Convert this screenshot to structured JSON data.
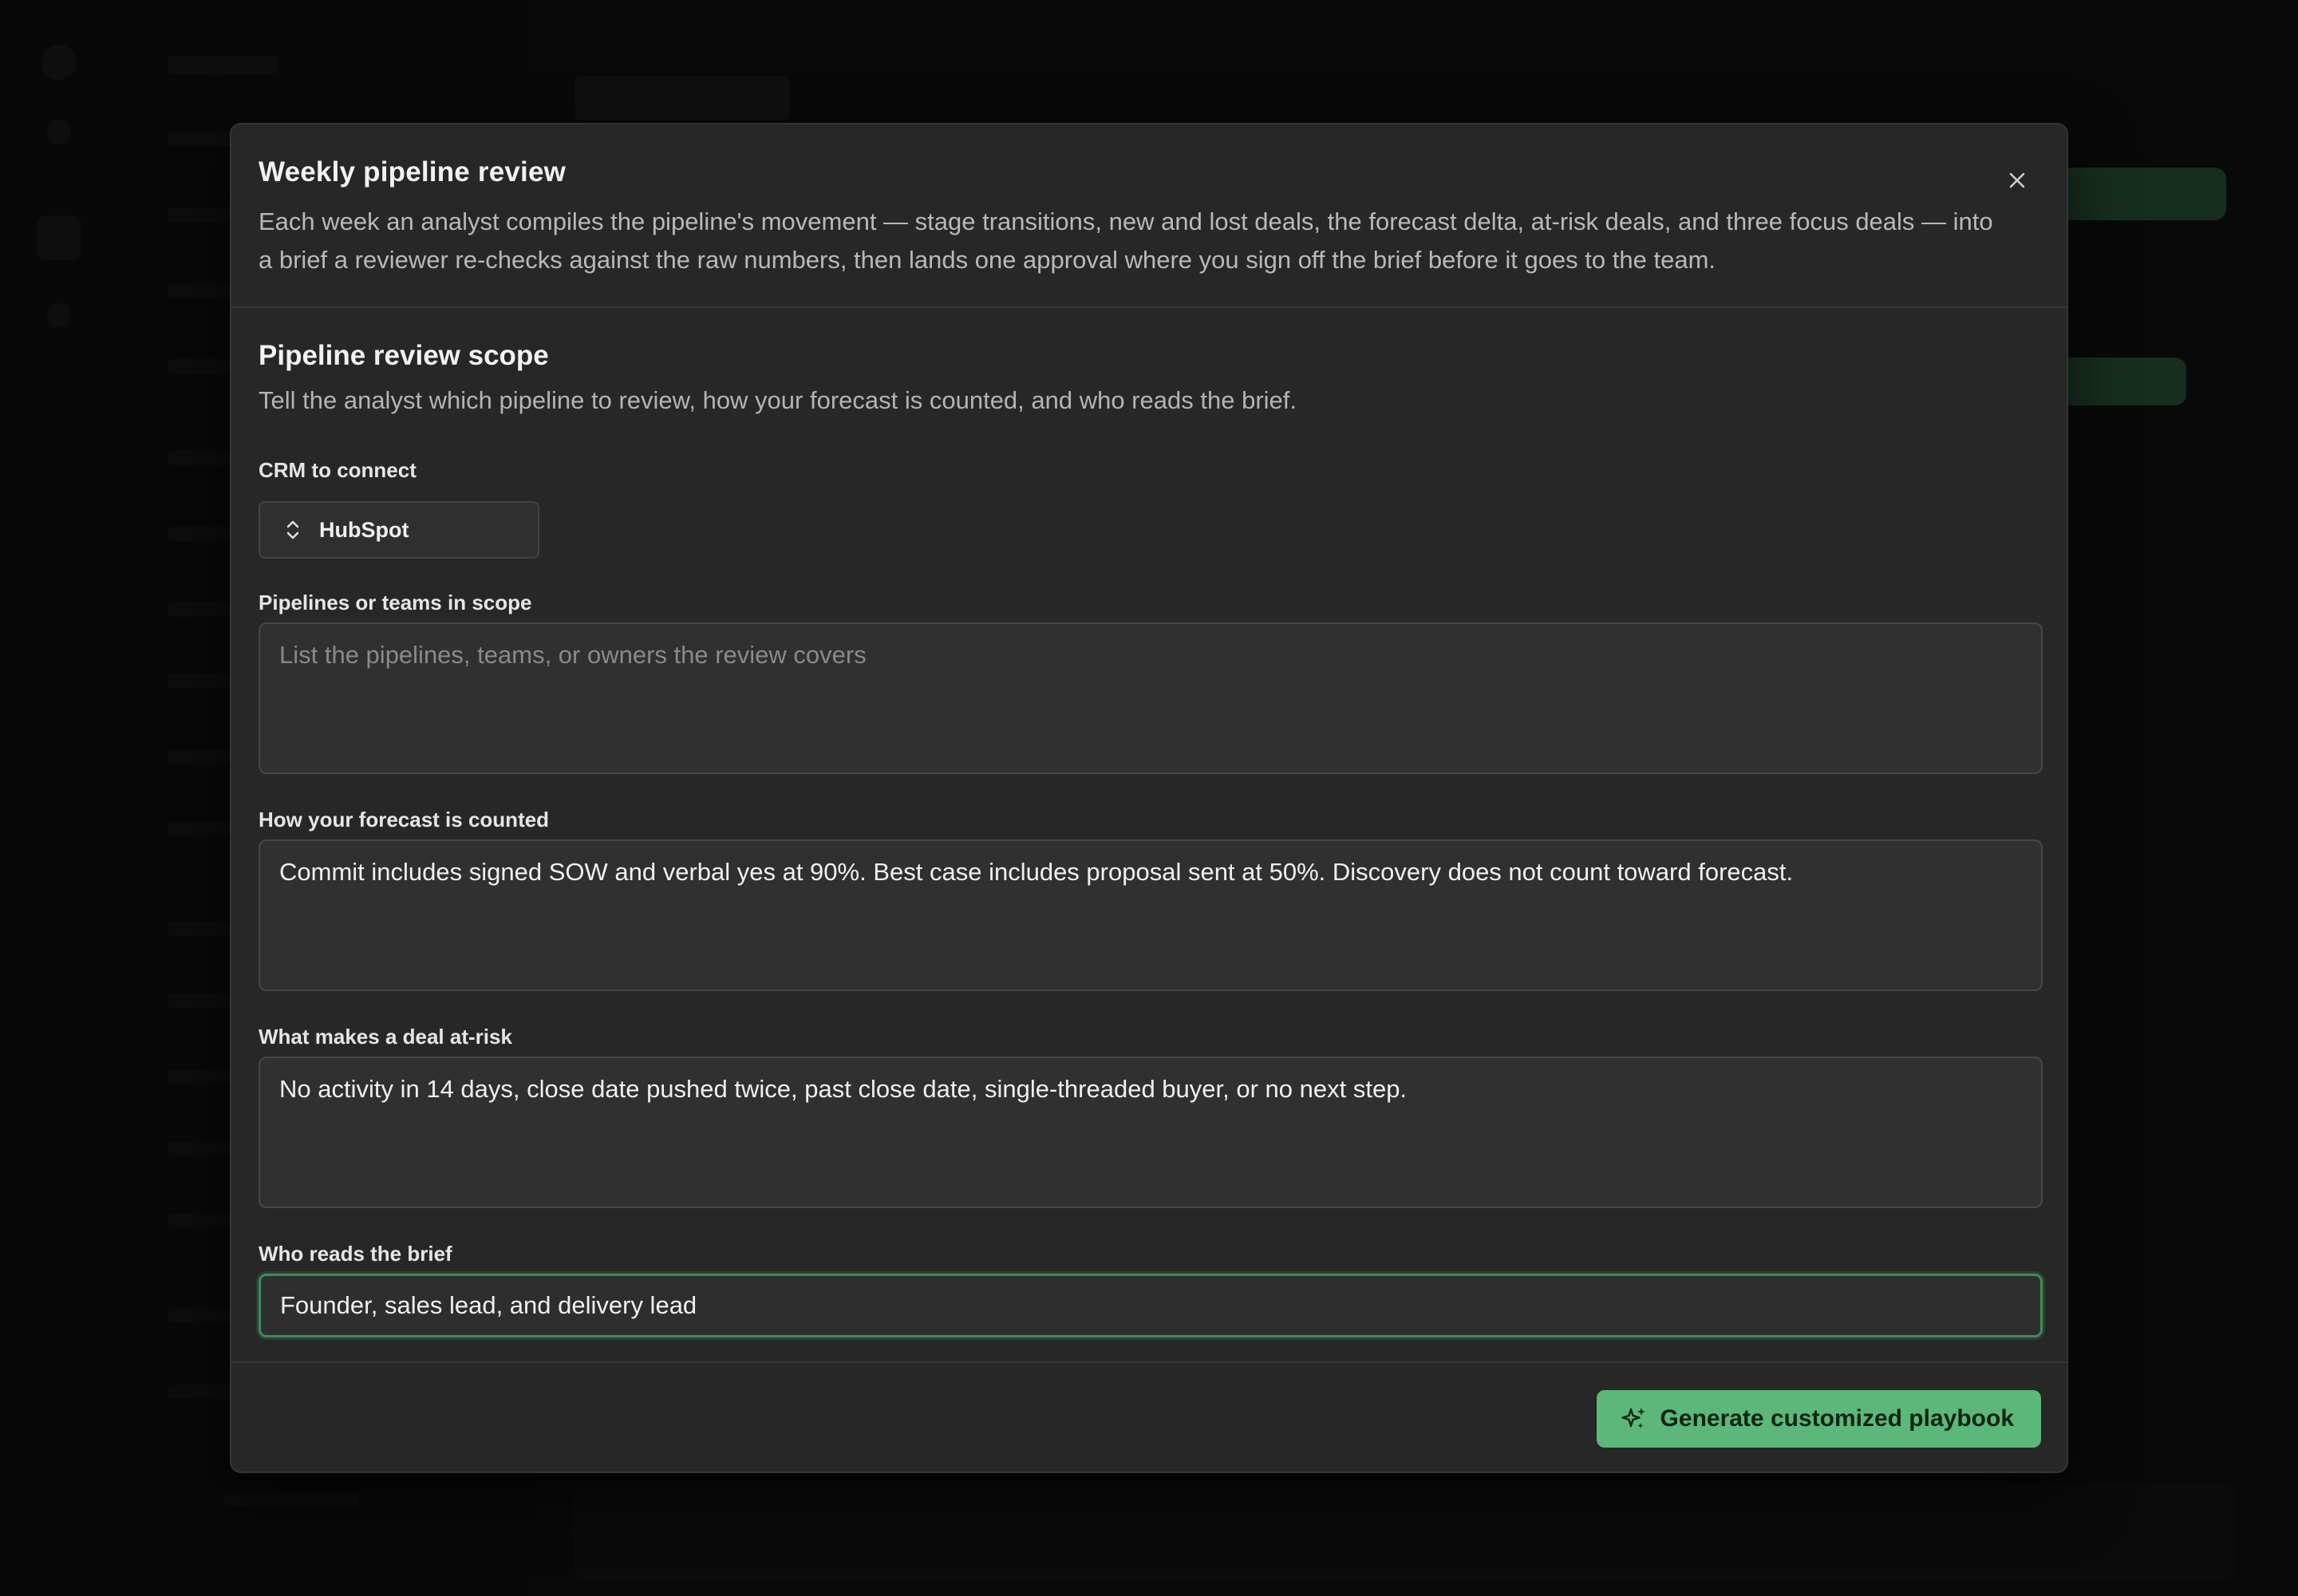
{
  "modal": {
    "title": "Weekly pipeline review",
    "description": "Each week an analyst compiles the pipeline's movement — stage transitions, new and lost deals, the forecast delta, at-risk deals, and three focus deals — into a brief a reviewer re-checks against the raw numbers, then lands one approval where you sign off the brief before it goes to the team.",
    "close_icon": "close-icon"
  },
  "section": {
    "title": "Pipeline review scope",
    "description": "Tell the analyst which pipeline to review, how your forecast is counted, and who reads the brief."
  },
  "fields": {
    "crm": {
      "label": "CRM to connect",
      "value": "HubSpot",
      "icon": "chevron-up-down-icon"
    },
    "pipelines": {
      "label": "Pipelines or teams in scope",
      "value": "",
      "placeholder": "List the pipelines, teams, or owners the review covers"
    },
    "forecast": {
      "label": "How your forecast is counted",
      "value": "Commit includes signed SOW and verbal yes at 90%. Best case includes proposal sent at 50%. Discovery does not count toward forecast."
    },
    "at_risk": {
      "label": "What makes a deal at-risk",
      "value": "No activity in 14 days, close date pushed twice, past close date, single-threaded buyer, or no next step."
    },
    "readers": {
      "label": "Who reads the brief",
      "value": "Founder, sales lead, and delivery lead"
    }
  },
  "footer": {
    "generate_label": "Generate customized playbook",
    "generate_icon": "sparkles-icon"
  },
  "colors": {
    "accent": "#5cb87a",
    "focus_border": "#3d8c58",
    "modal_bg": "#272727"
  }
}
